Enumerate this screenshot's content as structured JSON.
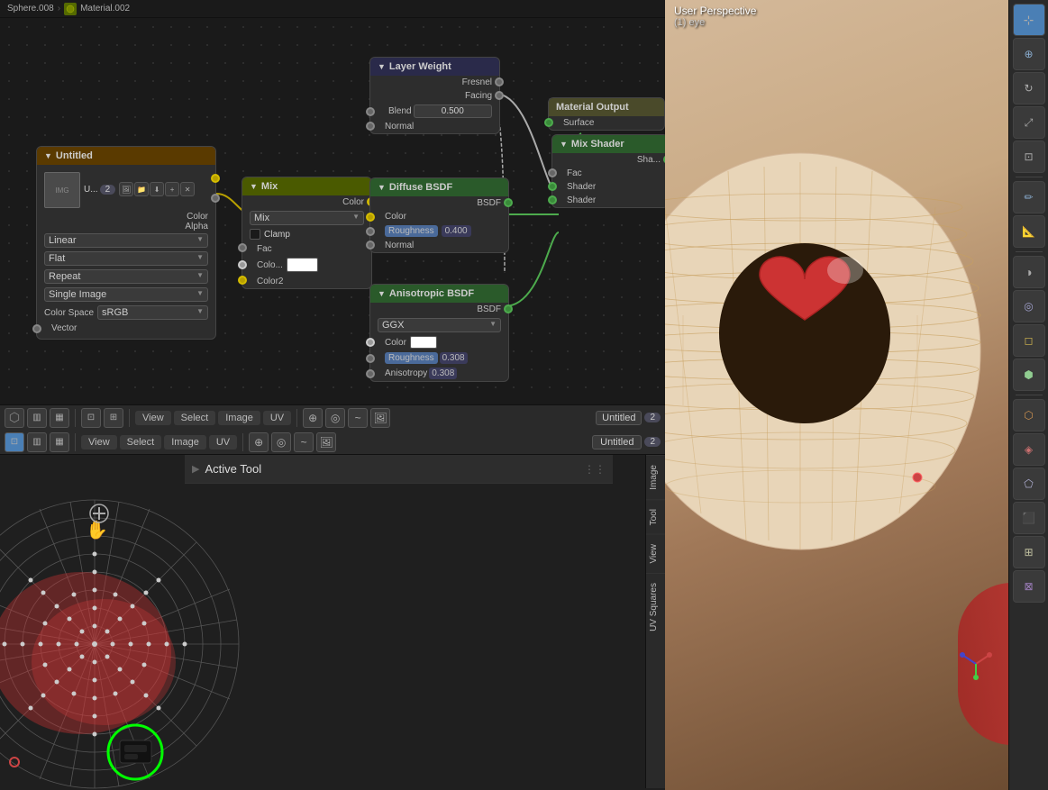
{
  "breadcrumb": {
    "sphere": "Sphere.008",
    "material": "Material.002"
  },
  "viewport": {
    "title": "User Perspective",
    "eye": "(1) eye"
  },
  "nodes": {
    "untitled": {
      "header": "Untitled",
      "rows": [
        {
          "label": "Color",
          "socket": "yellow"
        },
        {
          "label": "Alpha",
          "socket": "gray"
        }
      ],
      "image_label": "U...",
      "num": "2",
      "color_space_label": "Color Space",
      "color_space_val": "sRGB",
      "linear_label": "Linear",
      "flat_label": "Flat",
      "repeat_label": "Repeat",
      "single_image_label": "Single Image",
      "vector_label": "Vector"
    },
    "mix": {
      "header": "Mix",
      "type": "Mix",
      "rows": [
        {
          "label": "Color",
          "socket": "yellow"
        },
        {
          "label": "Fac"
        },
        {
          "label": "Colo...",
          "socket": "white"
        },
        {
          "label": "Color2",
          "socket": "yellow"
        }
      ],
      "clamp_label": "Clamp"
    },
    "layer_weight": {
      "header": "Layer Weight",
      "rows": [
        {
          "label": "Fresnel",
          "socket": "gray"
        },
        {
          "label": "Facing",
          "socket": "gray"
        },
        {
          "label": "Blend",
          "val": "0.500"
        },
        {
          "label": "Normal",
          "socket": "gray"
        }
      ]
    },
    "diffuse_bsdf": {
      "header": "Diffuse BSDF",
      "rows": [
        {
          "label": "BSDF",
          "socket": "green"
        },
        {
          "label": "Color",
          "socket": "gray"
        },
        {
          "label": "Roughness",
          "val": "0.400"
        },
        {
          "label": "Normal",
          "socket": "gray"
        }
      ]
    },
    "anisotropic_bsdf": {
      "header": "Anisotropic BSDF",
      "rows": [
        {
          "label": "BSDF",
          "socket": "green"
        },
        {
          "label": "GGX"
        },
        {
          "label": "Color",
          "socket": "white"
        },
        {
          "label": "Roughness",
          "val": "0.308"
        },
        {
          "label": "Anisotropy",
          "val": "0.308"
        }
      ]
    },
    "mix_shader": {
      "header": "Mix Shader",
      "rows": [
        {
          "label": "Sha..."
        },
        {
          "label": "Fac",
          "socket": "gray"
        },
        {
          "label": "Shader",
          "socket": "green"
        },
        {
          "label": "Shader",
          "socket": "green"
        }
      ]
    },
    "material_output": {
      "header": "Material Output",
      "rows": [
        {
          "label": "Surface",
          "socket": "green"
        }
      ]
    }
  },
  "node_toolbar": {
    "view": "View",
    "select": "Select",
    "image": "Image",
    "uv": "UV",
    "untitled": "Untitled",
    "num": "2"
  },
  "uv_toolbar": {
    "view": "View",
    "select": "Select",
    "image": "Image",
    "uv": "UV"
  },
  "active_tool": {
    "label": "Active Tool",
    "expand_icon": "▶"
  },
  "side_tabs": {
    "image": "Image",
    "tool": "Tool",
    "view": "View",
    "uv_squares": "UV Squares"
  },
  "toolbar_buttons": [
    {
      "name": "cursor",
      "icon": "⊹"
    },
    {
      "name": "move",
      "icon": "+"
    },
    {
      "name": "rotate",
      "icon": "↻"
    },
    {
      "name": "scale",
      "icon": "⤢"
    },
    {
      "name": "transform",
      "icon": "⊡"
    },
    {
      "name": "annotate",
      "icon": "✏"
    },
    {
      "name": "measure",
      "icon": "📐"
    },
    {
      "name": "add-cube",
      "icon": "◻"
    },
    {
      "name": "add-sphere",
      "icon": "◎"
    },
    {
      "name": "add-cylinder",
      "icon": "⬜"
    },
    {
      "name": "bisect",
      "icon": "⬡"
    },
    {
      "name": "shading",
      "icon": "◑"
    },
    {
      "name": "globe",
      "icon": "🌐"
    },
    {
      "name": "extra",
      "icon": "⬢"
    }
  ]
}
